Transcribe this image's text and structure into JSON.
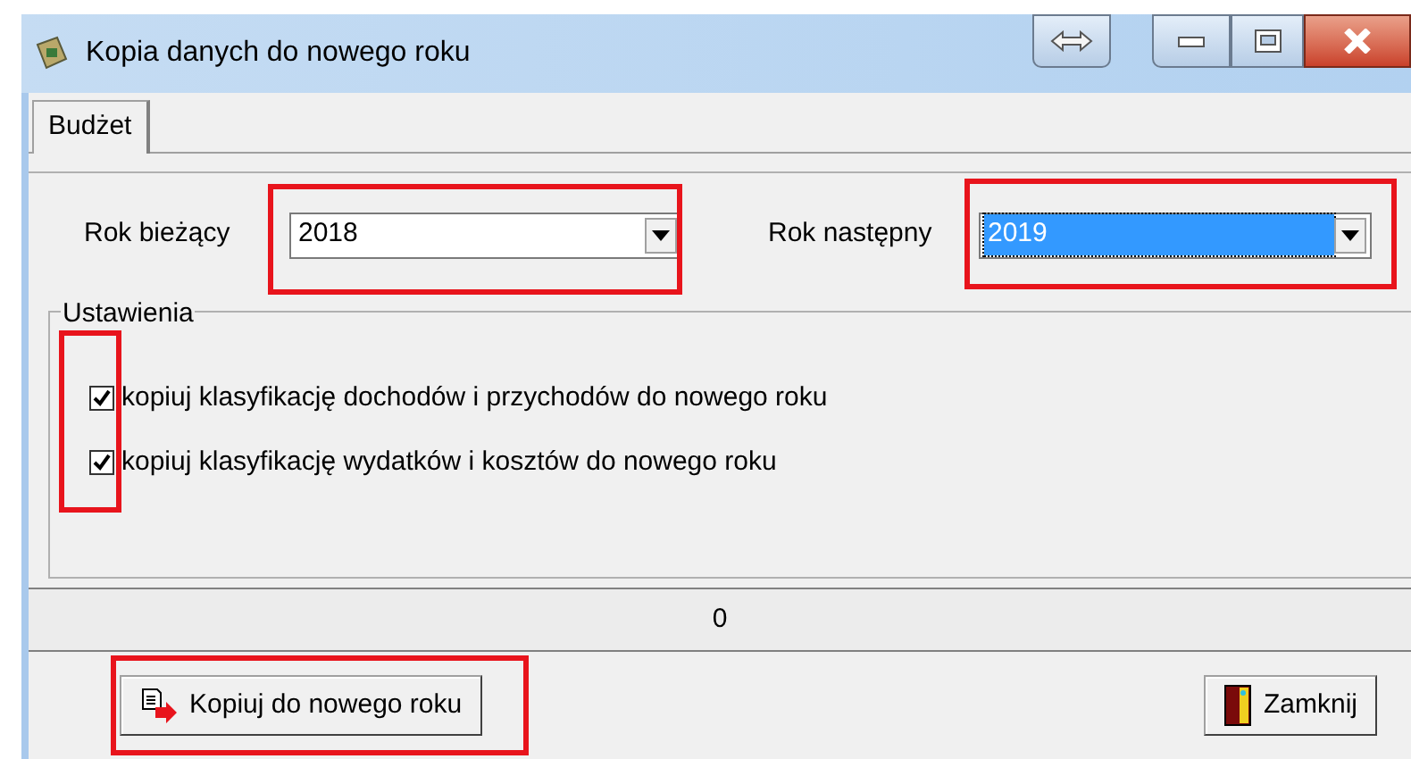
{
  "window": {
    "title": "Kopia danych do nowego roku"
  },
  "tabs": [
    {
      "label": "Budżet",
      "selected": true
    }
  ],
  "fields": [
    {
      "label": "Rok bieżący",
      "value": "2018",
      "selected": false,
      "highlighted": true
    },
    {
      "label": "Rok następny",
      "value": "2019",
      "selected": true,
      "highlighted": true
    }
  ],
  "settings": {
    "title": "Ustawienia",
    "highlighted": true,
    "options": [
      {
        "label": "kopiuj klasyfikację dochodów i przychodów do nowego roku",
        "checked": true
      },
      {
        "label": "kopiuj klasyfikację wydatków i kosztów do nowego roku",
        "checked": true
      }
    ]
  },
  "progress": {
    "text": "0"
  },
  "buttons": [
    {
      "kind": "copy",
      "label": "Kopiuj do nowego roku",
      "highlighted": true
    },
    {
      "kind": "close",
      "label": "Zamknij"
    }
  ]
}
